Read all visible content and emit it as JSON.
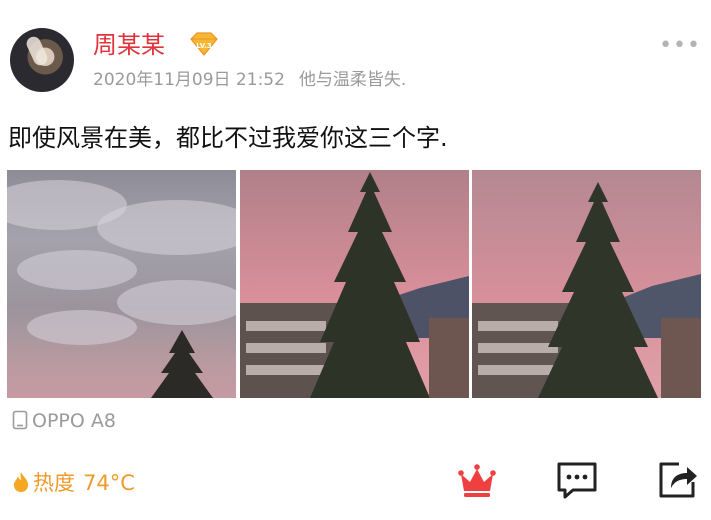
{
  "post": {
    "username": "周某某",
    "vip_badge_text": "LV.3",
    "timestamp": "2020年11月09日 21:52",
    "signature": "他与温柔皆失.",
    "content": "即使风景在美，都比不过我爱你这三个字.",
    "device": "OPPO A8",
    "heat_label": "热度",
    "heat_value": "74°C"
  },
  "colors": {
    "username": "#e0333b",
    "heat": "#f09a2b",
    "crown": "#ef3f3f",
    "meta": "#9a9a9a"
  },
  "icons": [
    "more-icon",
    "vip-badge-icon",
    "phone-icon",
    "flame-icon",
    "crown-icon",
    "comment-icon",
    "share-icon"
  ]
}
